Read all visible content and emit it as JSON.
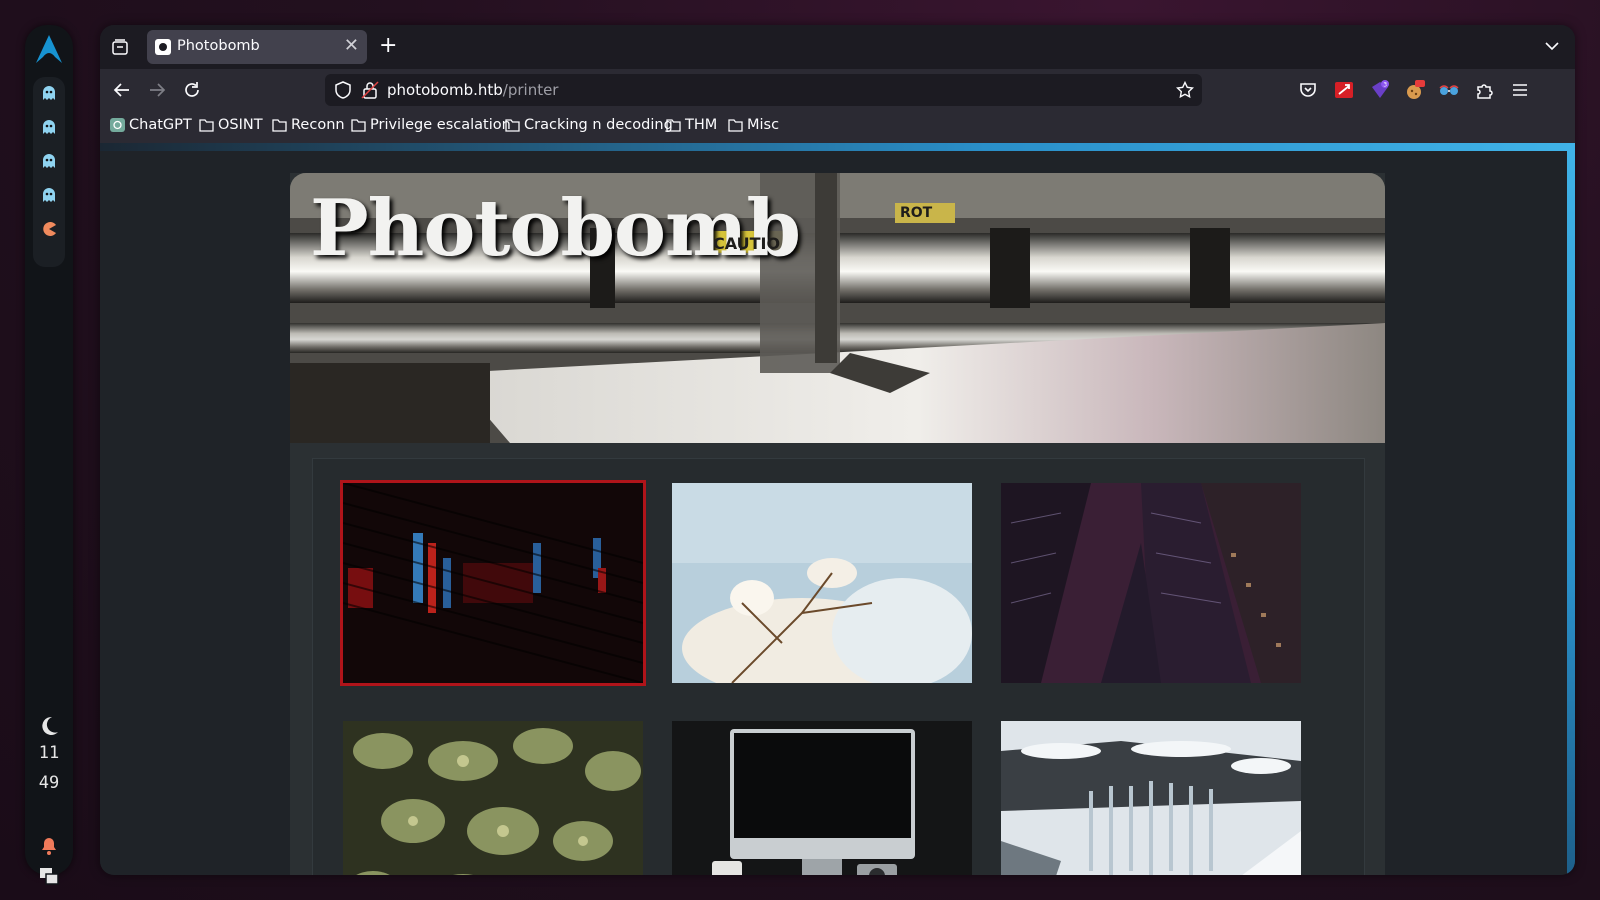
{
  "dock": {
    "clock_hour": "11",
    "clock_minute": "49",
    "icons": [
      "arch-logo-icon",
      "ghost-icon",
      "ghost-icon",
      "ghost-icon",
      "ghost-icon",
      "pacman-icon",
      "moon-icon",
      "bell-icon",
      "screen-icon"
    ]
  },
  "browser": {
    "tab": {
      "title": "Photobomb",
      "close_glyph": "✕"
    },
    "new_tab_glyph": "+",
    "url": {
      "host": "photobomb.htb",
      "path": "/printer"
    },
    "bookmarks": [
      {
        "label": "ChatGPT",
        "icon": "chatgpt-icon"
      },
      {
        "label": "OSINT",
        "icon": "folder-icon"
      },
      {
        "label": "Reconn",
        "icon": "folder-icon"
      },
      {
        "label": "Privilege escalation",
        "icon": "folder-icon"
      },
      {
        "label": "Cracking n decoding",
        "icon": "folder-icon"
      },
      {
        "label": "THM",
        "icon": "folder-icon"
      },
      {
        "label": "Misc",
        "icon": "folder-icon"
      }
    ]
  },
  "page": {
    "site_title": "Photobomb",
    "hero_stickers": [
      "CAUTIO",
      "ROT"
    ],
    "gallery": [
      {
        "name": "red-blue-lights-photo",
        "selected": true
      },
      {
        "name": "white-blossom-photo",
        "selected": false
      },
      {
        "name": "skyscrapers-photo",
        "selected": false
      },
      {
        "name": "succulent-plants-photo",
        "selected": false
      },
      {
        "name": "computer-desk-photo",
        "selected": false
      },
      {
        "name": "waterfall-photo",
        "selected": false
      }
    ]
  },
  "colors": {
    "accent_blue": "#40b3e8",
    "selection_red": "#b0141a",
    "page_bg": "#2b3033"
  }
}
